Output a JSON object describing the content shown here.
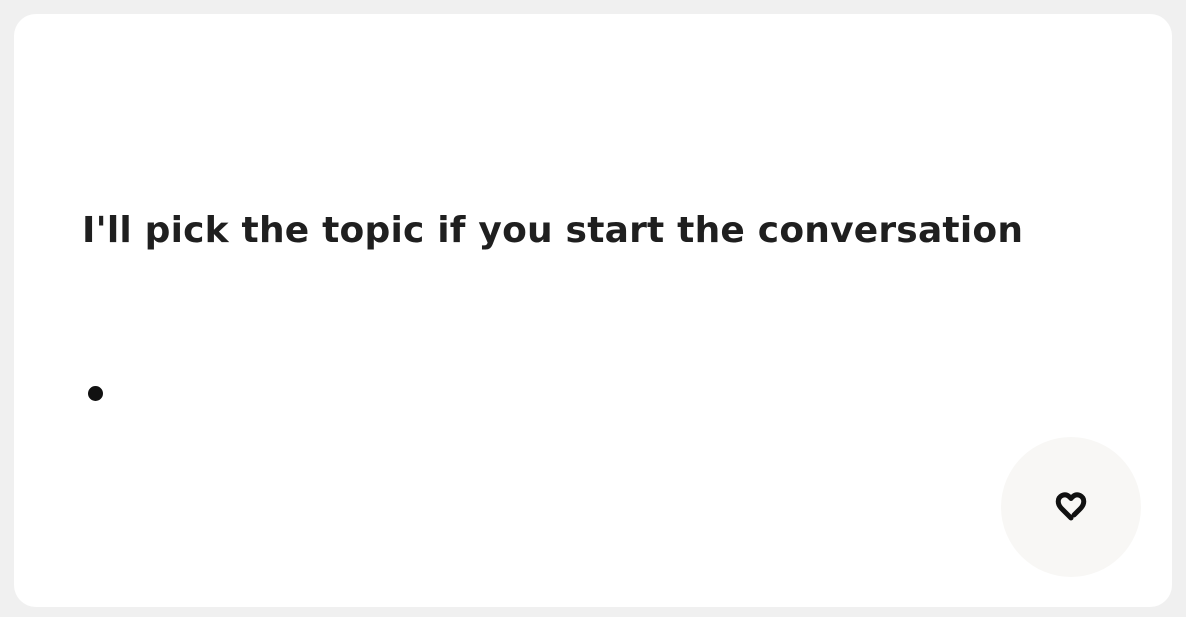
{
  "card": {
    "prompt": "I'll pick the topic if you start the conversation"
  },
  "like_button": {
    "icon": "heart-outline-icon"
  },
  "colors": {
    "page_background": "#f0f0f0",
    "card_background": "#ffffff",
    "text": "#1f1f1f",
    "button_background": "#f8f7f5"
  }
}
